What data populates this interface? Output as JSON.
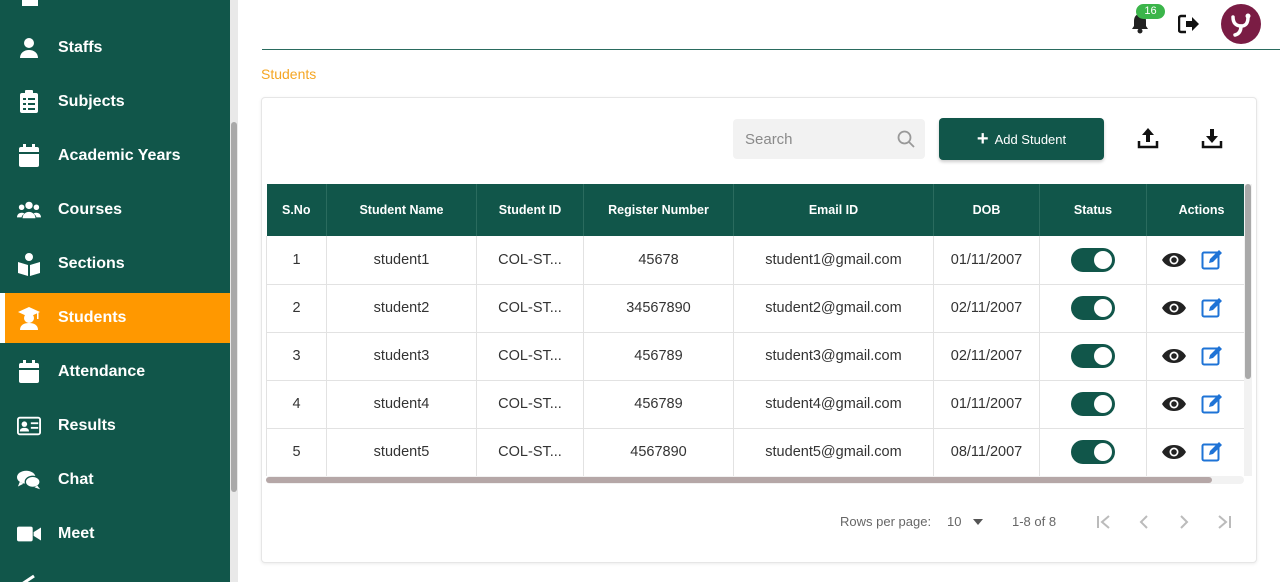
{
  "sidebar": {
    "items": [
      {
        "label": "Staffs",
        "icon": "person-icon"
      },
      {
        "label": "Subjects",
        "icon": "clipboard-icon"
      },
      {
        "label": "Academic Years",
        "icon": "calendar-icon"
      },
      {
        "label": "Courses",
        "icon": "users-icon"
      },
      {
        "label": "Sections",
        "icon": "book-reader-icon"
      },
      {
        "label": "Students",
        "icon": "graduate-icon",
        "active": true
      },
      {
        "label": "Attendance",
        "icon": "calendar-check-icon"
      },
      {
        "label": "Results",
        "icon": "id-card-icon"
      },
      {
        "label": "Chat",
        "icon": "chat-icon"
      },
      {
        "label": "Meet",
        "icon": "video-icon"
      }
    ]
  },
  "header": {
    "notification_count": "16"
  },
  "breadcrumb": "Students",
  "toolbar": {
    "search_placeholder": "Search",
    "add_label": "Add Student"
  },
  "table": {
    "columns": [
      "S.No",
      "Student Name",
      "Student ID",
      "Register Number",
      "Email ID",
      "DOB",
      "Status",
      "Actions"
    ],
    "rows": [
      {
        "sno": "1",
        "name": "student1",
        "id": "COL-ST...",
        "reg": "45678",
        "email": "student1@gmail.com",
        "dob": "01/11/2007"
      },
      {
        "sno": "2",
        "name": "student2",
        "id": "COL-ST...",
        "reg": "34567890",
        "email": "student2@gmail.com",
        "dob": "02/11/2007"
      },
      {
        "sno": "3",
        "name": "student3",
        "id": "COL-ST...",
        "reg": "456789",
        "email": "student3@gmail.com",
        "dob": "02/11/2007"
      },
      {
        "sno": "4",
        "name": "student4",
        "id": "COL-ST...",
        "reg": "456789",
        "email": "student4@gmail.com",
        "dob": "01/11/2007"
      },
      {
        "sno": "5",
        "name": "student5",
        "id": "COL-ST...",
        "reg": "4567890",
        "email": "student5@gmail.com",
        "dob": "08/11/2007"
      }
    ]
  },
  "pagination": {
    "rows_per_page_label": "Rows per page:",
    "rows_per_page": "10",
    "range": "1-8 of 8"
  },
  "colors": {
    "primary": "#11564a",
    "accent": "#ff9800",
    "badge": "#3bb54a",
    "avatar": "#7a1c44"
  }
}
